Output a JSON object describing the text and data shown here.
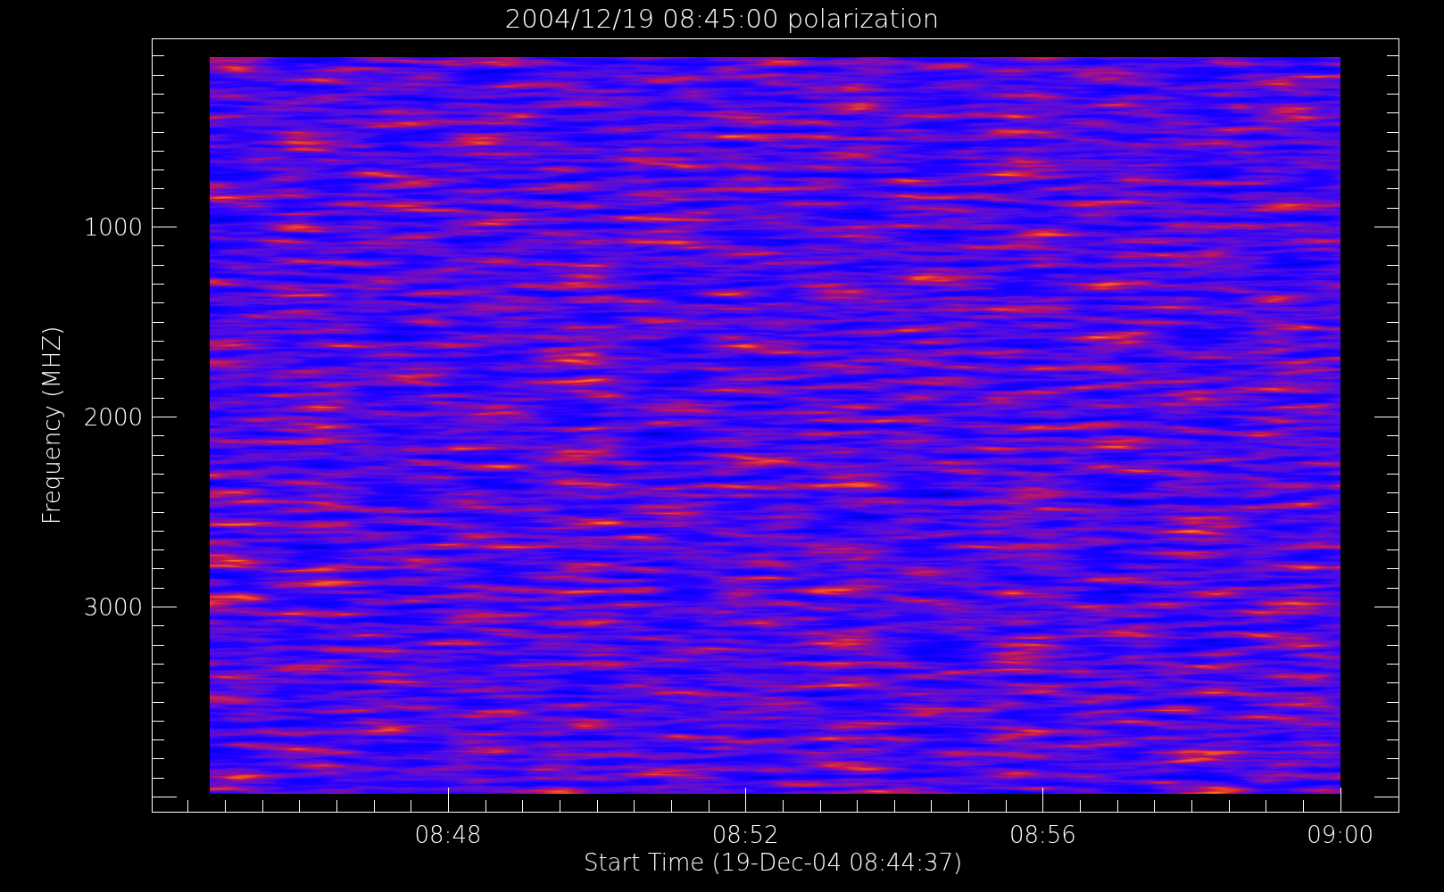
{
  "title": "2004/12/19 08:45:00 polarization",
  "ylabel": "Frequency (MHZ)",
  "xlabel": "Start Time (19-Dec-04 08:44:37)",
  "yticks": [
    "1000",
    "2000",
    "3000"
  ],
  "xticks": [
    "08:48",
    "08:52",
    "08:56",
    "09:00"
  ]
}
